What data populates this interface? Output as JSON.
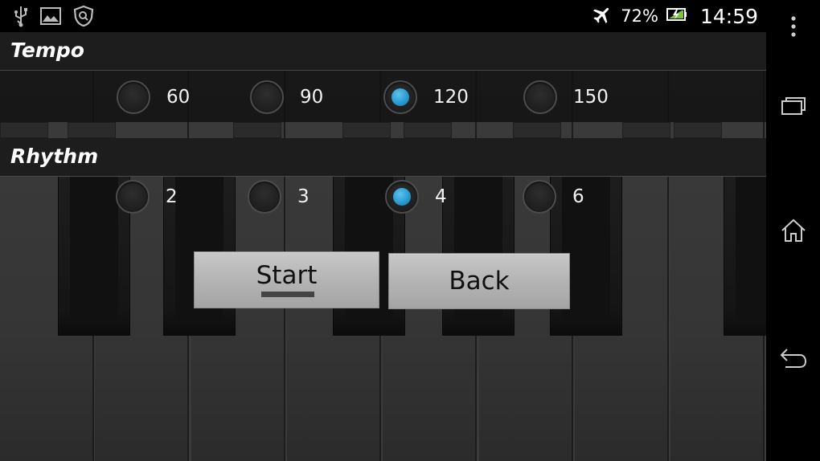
{
  "status_bar": {
    "icons": [
      "usb-icon",
      "image-icon",
      "shield-search-icon",
      "airplane-icon",
      "battery-charging-icon"
    ],
    "battery": "72%",
    "time": "14:59"
  },
  "nav_bar": {
    "icons": [
      "overflow-menu-icon",
      "recent-apps-icon",
      "home-icon",
      "back-icon"
    ]
  },
  "tempo": {
    "title": "Tempo",
    "options": [
      "60",
      "90",
      "120",
      "150"
    ],
    "selected": "120"
  },
  "rhythm": {
    "title": "Rhythm",
    "options": [
      "2",
      "3",
      "4",
      "6"
    ],
    "selected": "4"
  },
  "buttons": {
    "start": "Start",
    "back": "Back"
  },
  "colors": {
    "accent": "#2b9bd0",
    "button": "#b6b6b6",
    "header": "#1d1d1d"
  }
}
